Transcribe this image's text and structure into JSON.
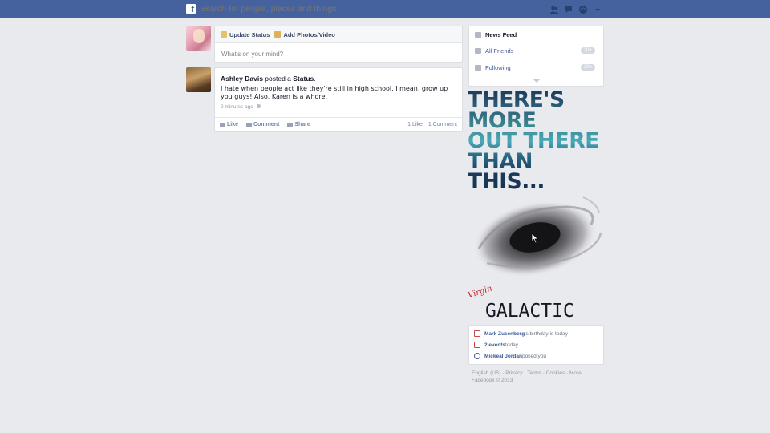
{
  "topbar": {
    "logo": "f",
    "search_placeholder": "Search for people, places and things",
    "icons": [
      "friends-icon",
      "messages-icon",
      "notifications-icon",
      "chevron-down-icon"
    ]
  },
  "composer": {
    "update_status": "Update Status",
    "add_photos": "Add Photos/Video",
    "placeholder": "What's on your mind?"
  },
  "post": {
    "author": "Ashley Davis",
    "action_prefix": " posted a ",
    "action_object": "Status",
    "action_suffix": ".",
    "text": "I hate when people act like they're still in high school. I mean, grow up you guys! Also, Karen is a whore.",
    "time": "2 minutes ago",
    "like_label": "Like",
    "comment_label": "Comment",
    "share_label": "Share",
    "likes_count": "1 Like",
    "comments_count": "1 Comment"
  },
  "nav": {
    "news_feed": "News Feed",
    "all_friends": "All Friends",
    "all_friends_badge": "20+",
    "following": "Following",
    "following_badge": "20+"
  },
  "ad": {
    "headline_lines": [
      "THERE'S",
      "MORE",
      "OUT THERE",
      "THAN",
      "THIS..."
    ],
    "brand_script": "Virgin",
    "brand": "GALACTIC"
  },
  "reminders": {
    "birthday_name": "Mark Zucenberg",
    "birthday_rest": "'s birthday is today",
    "events_bold": "2 events",
    "events_rest": " today",
    "poke_name": "Mickeal Jordan",
    "poke_rest": " poked you"
  },
  "footer": {
    "links": "English (US) · Privacy · Terms · Cookies · More",
    "copyright": "Facebook © 2013"
  }
}
